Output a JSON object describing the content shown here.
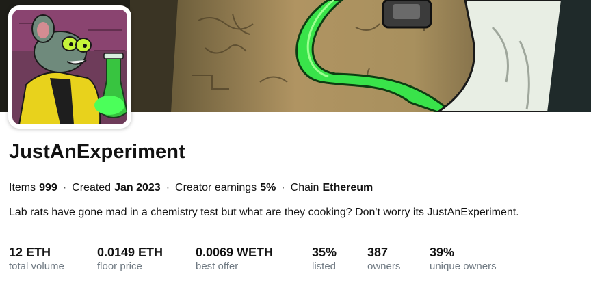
{
  "collection": {
    "name": "JustAnExperiment",
    "description": "Lab rats have gone mad in a chemistry test but what are they cooking? Don't worry its JustAnExperiment."
  },
  "meta": {
    "items_label": "Items",
    "items_value": "999",
    "created_label": "Created",
    "created_value": "Jan 2023",
    "earnings_label": "Creator earnings",
    "earnings_value": "5%",
    "chain_label": "Chain",
    "chain_value": "Ethereum",
    "separator": "·"
  },
  "stats": [
    {
      "value": "12 ETH",
      "label": "total volume"
    },
    {
      "value": "0.0149 ETH",
      "label": "floor price"
    },
    {
      "value": "0.0069 WETH",
      "label": "best offer"
    },
    {
      "value": "35%",
      "label": "listed"
    },
    {
      "value": "387",
      "label": "owners"
    },
    {
      "value": "39%",
      "label": "unique owners"
    }
  ],
  "colors": {
    "text": "#121212",
    "muted": "#707a83",
    "potion_green": "#39e34a",
    "banner_tan": "#b89a64"
  }
}
